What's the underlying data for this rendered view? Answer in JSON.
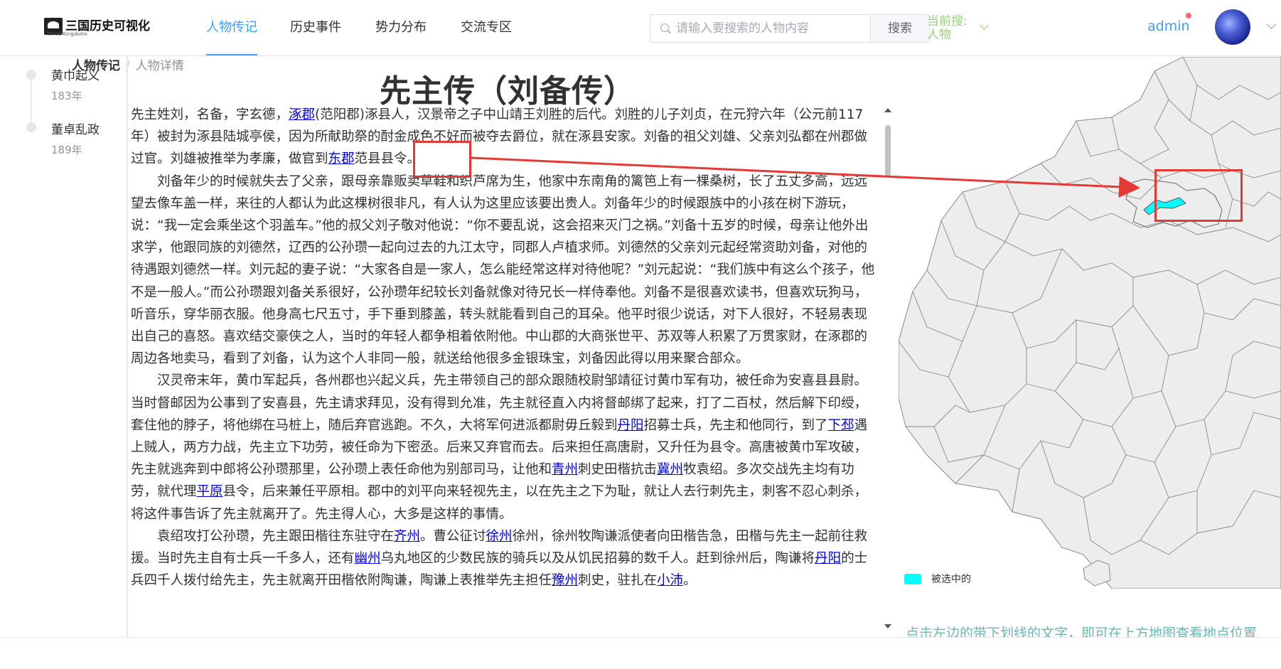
{
  "header": {
    "logo_text": "三国历史可视化",
    "logo_sub": "Three Kingdoms",
    "nav": [
      {
        "label": "人物传记",
        "active": true
      },
      {
        "label": "历史事件",
        "active": false
      },
      {
        "label": "势力分布",
        "active": false
      },
      {
        "label": "交流专区",
        "active": false
      }
    ],
    "search": {
      "placeholder": "请输入要搜索的人物内容",
      "button": "搜索"
    },
    "current_search": "当前搜:人物",
    "user": "admin"
  },
  "timeline": [
    {
      "title": "黄巾起义",
      "year": "183年"
    },
    {
      "title": "董卓乱政",
      "year": "189年"
    }
  ],
  "breadcrumb": {
    "parent": "人物传记",
    "separator": "/",
    "current": "人物详情"
  },
  "article": {
    "title": "先主传（刘备传）",
    "p1": [
      "先主姓刘，名备，字玄德，",
      {
        "link": "涿郡"
      },
      "(范阳郡)涿县人，汉景帝之子中山靖王刘胜的后代。刘胜的儿子刘贞，在元狩六年（公元前117年）被封为涿县陆城亭侯，因为所献助祭的酎金成色不好而被夺去爵位，就在涿县安家。刘备的祖父刘雄、父亲刘弘都在州郡做过官。刘雄被推举为孝廉，做官到",
      {
        "link": "东郡"
      },
      "范县县令。"
    ],
    "p2": [
      "刘备年少的时候就失去了父亲，跟母亲靠贩卖草鞋和织芦席为生，他家中东南角的篱笆上有一棵桑树，长了五丈多高，远远望去像车盖一样，来往的人都认为此这棵树很非凡，有人认为这里应该要出贵人。刘备年少的时候跟族中的小孩在树下游玩，说：“我一定会乘坐这个羽盖车。”他的叔父刘子敬对他说：“你不要乱说，这会招来灭门之祸。”刘备十五岁的时候，母亲让他外出求学，他跟同族的刘德然，辽西的公孙瓒一起向过去的九江太守，同郡人卢植求师。刘德然的父亲刘元起经常资助刘备，对他的待遇跟刘德然一样。刘元起的妻子说：“大家各自是一家人，怎么能经常这样对待他呢？”刘元起说：“我们族中有这么个孩子，他不是一般人。”而公孙瓒跟刘备关系很好，公孙瓒年纪较长刘备就像对待兄长一样侍奉他。刘备不是很喜欢读书，但喜欢玩狗马，听音乐，穿华丽衣服。他身高七尺五寸，手下垂到膝盖，转头就能看到自己的耳朵。他平时很少说话，对下人很好，不轻易表现出自己的喜怒。喜欢结交豪侠之人，当时的年轻人都争相着依附他。中山郡的大商张世平、苏双等人积累了万贯家财，在涿郡的周边各地卖马，看到了刘备，认为这个人非同一般，就送给他很多金银珠宝，刘备因此得以用来聚合部众。"
    ],
    "p3": [
      "汉灵帝末年，黄巾军起兵，各州郡也兴起义兵，先主带领自己的部众跟随校尉邹靖征讨黄巾军有功，被任命为安喜县县尉。当时督邮因为公事到了安喜县，先主请求拜见，没有得到允准，先主就径直入内将督邮绑了起来，打了二百杖，然后解下印绶，套住他的脖子，将他绑在马桩上，随后弃官逃跑。不久，大将军何进派都尉毋丘毅到",
      {
        "link": "丹阳"
      },
      "招募士兵，先主和他同行，到了",
      {
        "link": "下邳"
      },
      "遇上贼人，两方力战，先主立下功劳，被任命为下密丞。后来又弃官而去。后来担任高唐尉，又升任为县令。高唐被黄巾军攻破，先主就逃奔到中郎将公孙瓒那里，公孙瓒上表任命他为别部司马，让他和",
      {
        "link": "青州"
      },
      "刺史田楷抗击",
      {
        "link": "冀州"
      },
      "牧袁绍。多次交战先主均有功劳，就代理",
      {
        "link": "平原"
      },
      "县令，后来兼任平原相。郡中的刘平向来轻视先主，以在先主之下为耻，就让人去行刺先主，刺客不忍心刺杀，将这件事告诉了先主就离开了。先主得人心，大多是这样的事情。"
    ],
    "p4": [
      "袁绍攻打公孙瓒，先主跟田楷往东驻守在",
      {
        "link": "齐州"
      },
      "。曹公征讨",
      {
        "link": "徐州"
      },
      "徐州，徐州牧陶谦派使者向田楷告急，田楷与先主一起前往救援。当时先主自有士兵一千多人，还有",
      {
        "link": "幽州"
      },
      "乌丸地区的少数民族的骑兵以及从饥民招募的数千人。赶到徐州后，陶谦将",
      {
        "link": "丹阳"
      },
      "的士兵四千人拨付给先主，先主就离开田楷依附陶谦，陶谦上表推举先主担任",
      {
        "link": "豫州"
      },
      "刺史，驻扎在",
      {
        "link": "小沛"
      },
      "。"
    ]
  },
  "map": {
    "legend_label": "被选中的",
    "highlight_color": "#00ffff",
    "hint": "点击左边的带下划线的文字，即可在上方地图查看地点位置"
  },
  "colors": {
    "accent": "#409eff",
    "annotation": "#e53935",
    "map_fill": "#ededed",
    "map_border": "#888888"
  }
}
